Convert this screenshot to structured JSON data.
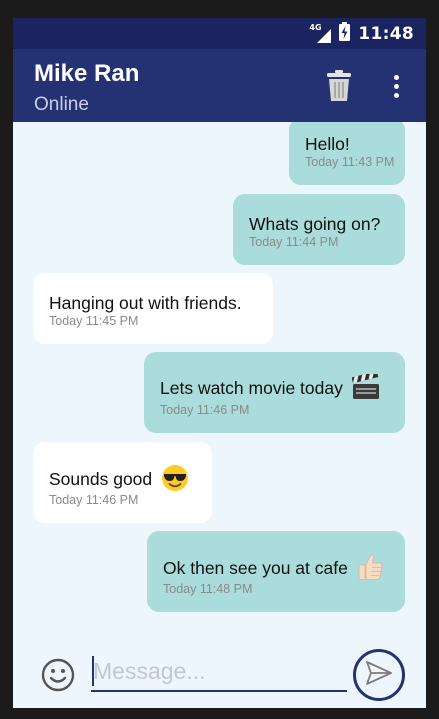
{
  "status_bar": {
    "network": "4G",
    "time": "11:48",
    "icons": [
      "signal-icon",
      "battery-charging-icon"
    ]
  },
  "app_bar": {
    "title": "Mike Ran",
    "subtitle": "Online",
    "actions": [
      "trash-icon",
      "overflow-menu-icon"
    ]
  },
  "messages": [
    {
      "direction": "out",
      "text": "Hello!",
      "time": "Today 11:43 PM"
    },
    {
      "direction": "out",
      "text": "Whats going on?",
      "time": "Today 11:44 PM"
    },
    {
      "direction": "in",
      "text": "Hanging out with friends.",
      "time": "Today 11:45 PM"
    },
    {
      "direction": "out",
      "text": "Lets watch movie today",
      "emoji": "clapper-board-icon",
      "time": "Today 11:46 PM"
    },
    {
      "direction": "in",
      "text": "Sounds good",
      "emoji": "sunglasses-face-icon",
      "time": "Today 11:46 PM"
    },
    {
      "direction": "out",
      "text": "Ok then see you at cafe",
      "emoji": "thumbs-up-icon",
      "time": "Today 11:48 PM"
    }
  ],
  "composer": {
    "placeholder": "Message...",
    "value": ""
  },
  "colors": {
    "status_bar": "#1b2360",
    "app_bar": "#243172",
    "chat_background": "#eef6fd",
    "outgoing_bubble": "#a9dcda",
    "incoming_bubble": "#ffffff"
  }
}
